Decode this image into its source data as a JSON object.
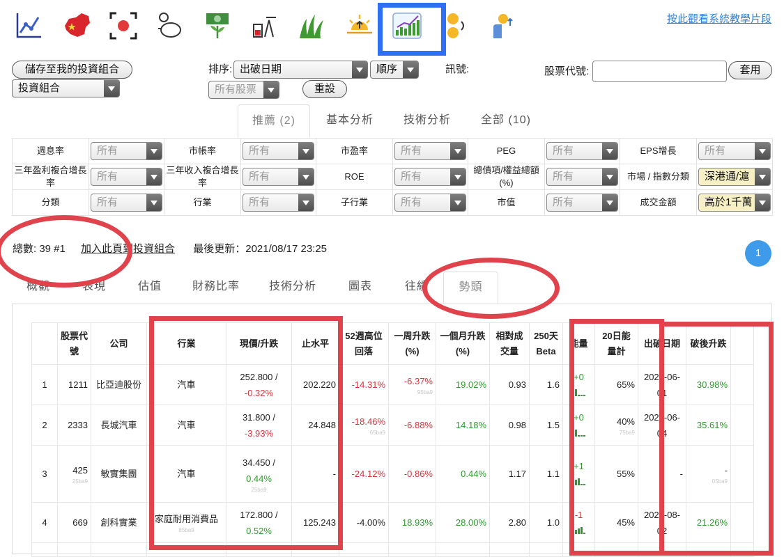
{
  "tutorial_link": "按此觀看系統教學片段",
  "toolbar_icons": [
    "line-chart-icon",
    "china-map-icon",
    "target-icon",
    "piggy-bank-icon",
    "money-growth-icon",
    "oil-pump-icon",
    "grass-icon",
    "sunrise-icon",
    "trend-chart-icon",
    "coins-icon",
    "hand-coin-icon"
  ],
  "controls": {
    "save_label": "儲存至我的投資組合",
    "portfolio_select": "投資組合",
    "sort_label": "排序:",
    "sort_select": "出破日期",
    "order_select": "順序",
    "signal_label": "訊號:",
    "stock_filter_select": "所有股票",
    "reset_label": "重設",
    "code_label": "股票代號:",
    "apply_label": "套用"
  },
  "category_tabs": [
    "推薦 (2)",
    "基本分析",
    "技術分析",
    "全部 (10)"
  ],
  "filters": {
    "rows": [
      [
        {
          "label": "週息率",
          "value": "所有"
        },
        {
          "label": "市帳率",
          "value": "所有"
        },
        {
          "label": "市盈率",
          "value": "所有"
        },
        {
          "label": "PEG",
          "value": "所有"
        },
        {
          "label": "EPS增長",
          "value": "所有"
        }
      ],
      [
        {
          "label": "三年盈利複合增長率",
          "value": "所有"
        },
        {
          "label": "三年收入複合增長率",
          "value": "所有"
        },
        {
          "label": "ROE",
          "value": "所有"
        },
        {
          "label": "總債項/權益總額(%)",
          "value": "所有"
        },
        {
          "label": "市場 / 指數分類",
          "value": "深港通/滬"
        }
      ],
      [
        {
          "label": "分類",
          "value": "所有"
        },
        {
          "label": "行業",
          "value": "所有"
        },
        {
          "label": "子行業",
          "value": "所有"
        },
        {
          "label": "市值",
          "value": "所有"
        },
        {
          "label": "成交金額",
          "value": "高於1千萬"
        }
      ]
    ]
  },
  "summary": {
    "count": "總數: 39 #1",
    "add_link": "加入此頁到投資組合",
    "updated": "最後更新：2021/08/17 23:25",
    "page": "1"
  },
  "view_tabs": [
    "概觀",
    "表現",
    "估值",
    "財務比率",
    "技術分析",
    "圖表",
    "往績",
    "勢頭"
  ],
  "table": {
    "headers": [
      "",
      "股票代號",
      "公司",
      "行業",
      "現價/升跌",
      "止水平",
      "52週高位回落",
      "一周升跌(%)",
      "一個月升跌(%)",
      "相對成交量",
      "250天Beta",
      "能量",
      "20日能量計",
      "出破日期",
      "破後升跌"
    ],
    "rows": [
      {
        "idx": "1",
        "code": "1211",
        "company": "比亞迪股份",
        "industry": "汽車",
        "price": "252.800 /",
        "chg": "-0.32%",
        "stop": "202.220",
        "off52": "-14.31%",
        "week": "-6.37%",
        "week_note": "95ba9",
        "month": "19.02%",
        "relvol": "0.93",
        "beta": "1.6",
        "energy": "+0",
        "meter": "65%",
        "break_date": "2021-06-01",
        "after": "30.98%"
      },
      {
        "idx": "2",
        "code": "2333",
        "company": "長城汽車",
        "industry": "汽車",
        "price": "31.800 /",
        "chg": "-3.93%",
        "stop": "24.848",
        "off52": "-18.46%",
        "off52_note": "65ba9",
        "week": "-6.88%",
        "month": "14.18%",
        "relvol": "0.98",
        "beta": "1.5",
        "energy": "+0",
        "meter": "40%",
        "meter_note": "75ba9",
        "break_date": "2021-06-04",
        "after": "35.61%"
      },
      {
        "idx": "3",
        "code": "425",
        "code_note": "25ba9",
        "company": "敏實集團",
        "industry": "汽車",
        "price": "34.450 /",
        "chg": "0.44%",
        "price_note": "25ba9",
        "stop": "-",
        "off52": "-24.12%",
        "week": "-0.86%",
        "month": "0.44%",
        "relvol": "1.17",
        "beta": "1.1",
        "energy": "+1",
        "meter": "55%",
        "break_date": "-",
        "after": "-",
        "after_note": "05ba9"
      },
      {
        "idx": "4",
        "code": "669",
        "company": "創科實業",
        "industry": "家庭耐用消費品",
        "industry_note": "85ba9",
        "price": "172.800 /",
        "chg": "0.52%",
        "stop": "125.243",
        "off52": "-4.00%",
        "week": "18.93%",
        "month": "28.00%",
        "relvol": "2.80",
        "beta": "1.0",
        "energy": "-1",
        "meter": "45%",
        "break_date": "2021-08-02",
        "after": "21.26%"
      }
    ]
  },
  "colors": {
    "accent": "#2f6ff3",
    "annotation": "#e0434c",
    "link": "#2f7fd8",
    "up": "#2f9a2f",
    "down": "#d9333a"
  }
}
